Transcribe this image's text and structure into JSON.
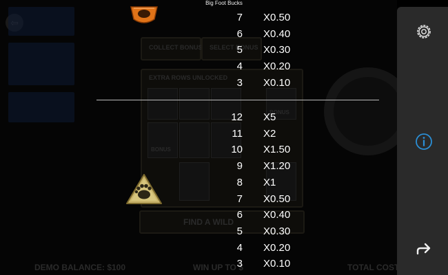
{
  "window": {
    "title": "Big Foot Bucks"
  },
  "background": {
    "buttons": [
      "COLLECT BONUS",
      "SELECT BONUS"
    ],
    "banner": "EXTRA ROWS UNLOCKED",
    "find_text": "FIND A WILD",
    "bonus_labels": [
      "BONUS",
      "BONUS"
    ],
    "demo_balance": "DEMO BALANCE: $100",
    "win_up_to": "WIN UP TO $",
    "total_cost": "TOTAL COST $"
  },
  "paytable": {
    "upper_symbol": "orange-gem-icon",
    "upper": [
      {
        "count": "7",
        "multiplier": "X0.50"
      },
      {
        "count": "6",
        "multiplier": "X0.40"
      },
      {
        "count": "5",
        "multiplier": "X0.30"
      },
      {
        "count": "4",
        "multiplier": "X0.20"
      },
      {
        "count": "3",
        "multiplier": "X0.10"
      }
    ],
    "lower_symbol": "bigfoot-footprint-icon",
    "lower": [
      {
        "count": "12",
        "multiplier": "X5"
      },
      {
        "count": "11",
        "multiplier": "X2"
      },
      {
        "count": "10",
        "multiplier": "X1.50"
      },
      {
        "count": "9",
        "multiplier": "X1.20"
      },
      {
        "count": "8",
        "multiplier": "X1"
      },
      {
        "count": "7",
        "multiplier": "X0.50"
      },
      {
        "count": "6",
        "multiplier": "X0.40"
      },
      {
        "count": "5",
        "multiplier": "X0.30"
      },
      {
        "count": "4",
        "multiplier": "X0.20"
      },
      {
        "count": "3",
        "multiplier": "X0.10"
      }
    ]
  },
  "sidebar": {
    "settings_icon": "gear-icon",
    "info_icon": "info-icon",
    "return_icon": "return-arrow-icon"
  },
  "colors": {
    "accent": "#2b8fd6",
    "sidebar": "#2a2a2a",
    "symbol_gold": "#c9b46a"
  }
}
